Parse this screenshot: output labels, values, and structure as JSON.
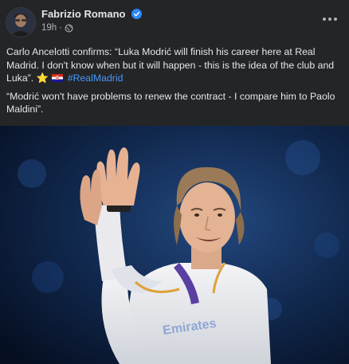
{
  "post": {
    "author": "Fabrizio Romano",
    "time": "19h",
    "separator": "·",
    "paragraph1_text": "Carlo Ancelotti confirms: “Luka Modrić will finish his career here at Real Madrid. I don't know when but it will happen - this is the idea of the club and Luka”. ",
    "star_emoji": "⭐",
    "hashtag": "#RealMadrid",
    "paragraph2_text": "“Modrić won't have problems to renew the contract - I compare him to Paolo Maldini”."
  },
  "icons": {
    "verified": "verified-badge-icon",
    "audience": "globe-icon",
    "more": "more-options-icon",
    "flag": "croatia-flag-icon"
  },
  "colors": {
    "background": "#242526",
    "text": "#e4e6eb",
    "secondary_text": "#b0b3b8",
    "link": "#4599ff",
    "verified": "#2d88ff"
  }
}
